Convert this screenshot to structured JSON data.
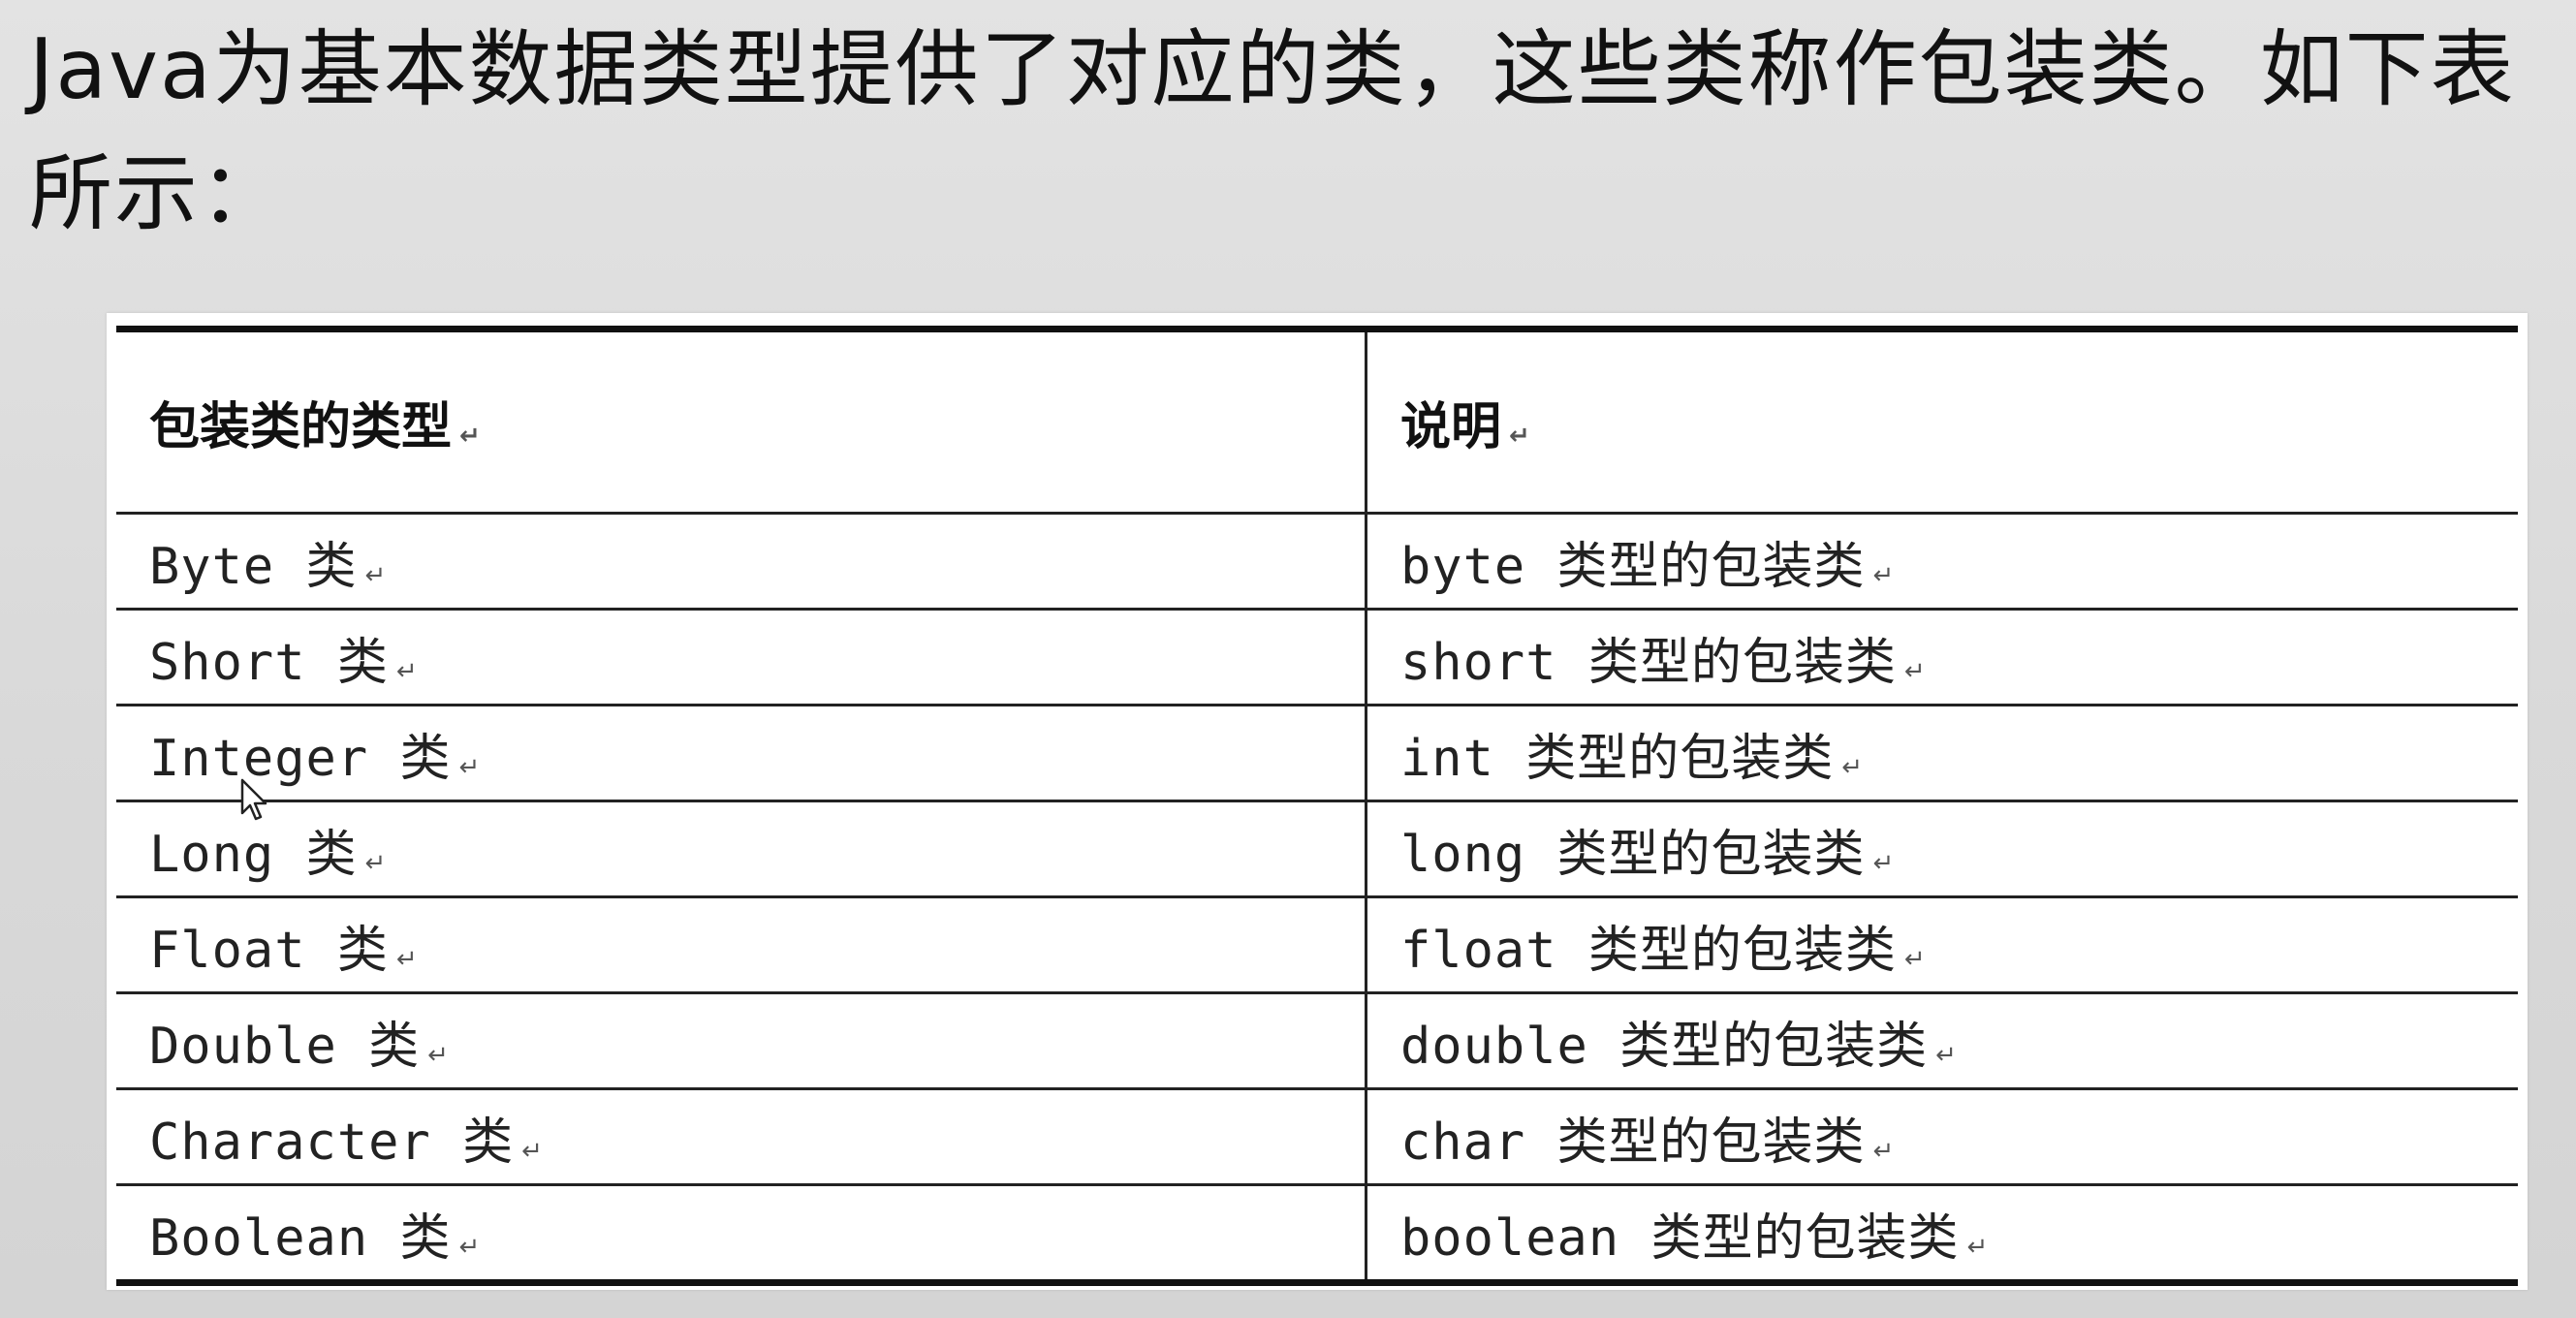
{
  "intro_text": "Java为基本数据类型提供了对应的类，这些类称作包装类。如下表所示：",
  "table": {
    "headers": [
      "包装类的类型",
      "说明"
    ],
    "rows": [
      [
        "Byte 类",
        "byte 类型的包装类"
      ],
      [
        "Short 类",
        "short 类型的包装类"
      ],
      [
        "Integer 类",
        "int 类型的包装类"
      ],
      [
        "Long 类",
        "long 类型的包装类"
      ],
      [
        "Float 类",
        "float 类型的包装类"
      ],
      [
        "Double 类",
        "double 类型的包装类"
      ],
      [
        "Character 类",
        "char 类型的包装类"
      ],
      [
        "Boolean 类",
        "boolean 类型的包装类"
      ]
    ]
  },
  "paragraph_mark": "↵",
  "icons": {
    "cursor": "mouse-pointer-icon"
  }
}
